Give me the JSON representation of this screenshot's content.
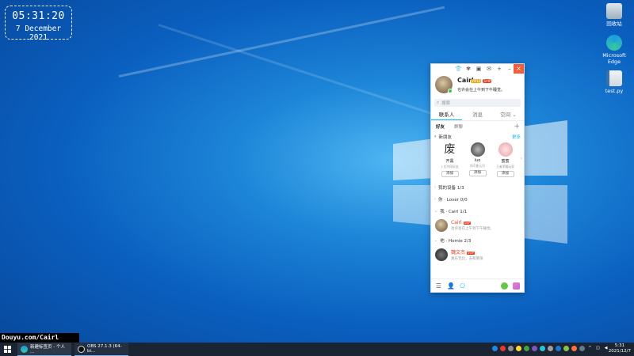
{
  "clock_widget": {
    "time": "05:31:20",
    "date": "7 December 2021"
  },
  "desktop_icons": [
    {
      "label": "回收站",
      "icon": "recycle-bin-icon"
    },
    {
      "label": "Microsoft Edge",
      "icon": "edge-icon"
    },
    {
      "label": "test.py",
      "icon": "python-file-icon"
    }
  ],
  "watermark": "Douyu.com/Cairl",
  "qq": {
    "titlebar_icons": [
      "shirt-icon",
      "butterfly-icon",
      "gift-icon",
      "mail-icon",
      "plus-icon",
      "minimize-icon"
    ],
    "close": "×",
    "profile": {
      "nickname": "Cairl",
      "badge_vip": "VIP10",
      "badge_svip": "SVIP",
      "signature": "也许会在上午到下午睡觉。"
    },
    "search_placeholder": "搜索",
    "tabs": [
      "联系人",
      "消息",
      "空间"
    ],
    "subtabs": [
      "好友",
      "群聊"
    ],
    "new_friends": {
      "title": "新朋友",
      "more": "更多",
      "items": [
        {
          "name": "开黑",
          "glyph": "废",
          "sub": "1 位共同好友",
          "add": "添加"
        },
        {
          "name": "luo",
          "sub": "你可能认识",
          "add": "添加"
        },
        {
          "name": "蜜蜜",
          "sub": "王者荣耀玩家",
          "add": "添加"
        }
      ]
    },
    "groups": [
      {
        "label": "我的设备 1/3"
      },
      {
        "label": "你 · Lover 0/0"
      },
      {
        "label": "我 · Cairl 1/1"
      }
    ],
    "contact_me": {
      "name": "Cairl",
      "badge": "SVIP",
      "sub": "也许会在上午到下午睡觉。"
    },
    "group_homie": {
      "label": "他 · Homie 2/3"
    },
    "contact_homie": {
      "name": "魏文杰",
      "badge": "SVIP",
      "sub": "真乐无比，去和莱阳"
    }
  },
  "taskbar": {
    "items": [
      {
        "label": "新建标签页 - 个人 ...",
        "icon": "edge-icon"
      },
      {
        "label": "OBS 27.1.3 (64-bi...",
        "icon": "obs-icon"
      }
    ],
    "clock_time": "5:31",
    "clock_date": "2021/12/7"
  }
}
